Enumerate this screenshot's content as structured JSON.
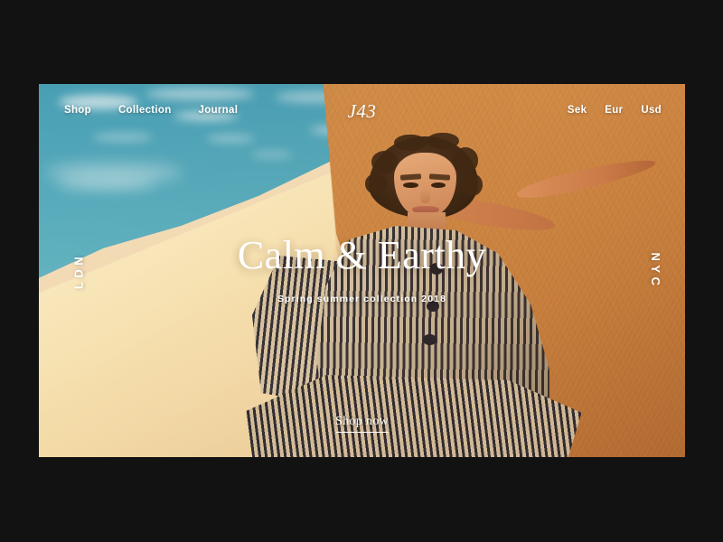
{
  "page": {
    "background_color": "#121212"
  },
  "hero": {
    "image_alt": "Woman in striped shirt dress seated on a sunlit desert dune",
    "sky_color": "#4da8c0",
    "dune_color": "#f0ddb0",
    "rock_color": "#cc8a4a",
    "garment_stripe_color": "#2a2a35"
  },
  "nav": {
    "items": [
      {
        "label": "Shop"
      },
      {
        "label": "Collection"
      },
      {
        "label": "Journal"
      }
    ]
  },
  "logo": {
    "text": "J43"
  },
  "currency": {
    "options": [
      {
        "label": "Sek"
      },
      {
        "label": "Eur"
      },
      {
        "label": "Usd"
      }
    ]
  },
  "side_labels": {
    "left": "LDN",
    "right": "NYC"
  },
  "headline": {
    "title": "Calm & Earthy",
    "subtitle": "Spring summer collection 2018"
  },
  "cta": {
    "label": "Shop now"
  }
}
